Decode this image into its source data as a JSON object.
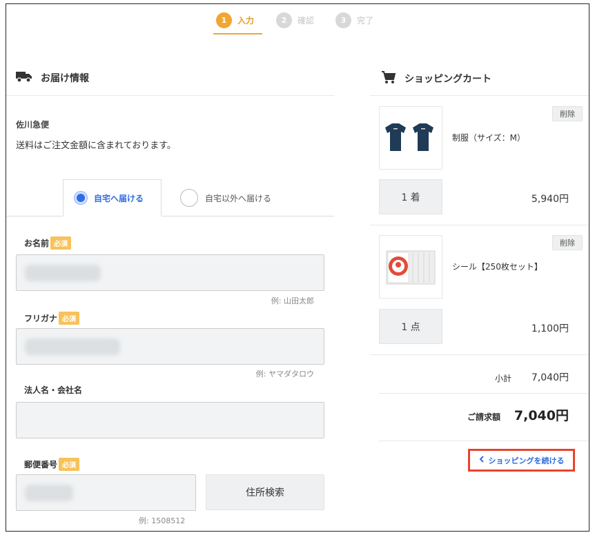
{
  "steps": [
    {
      "num": "1",
      "label": "入力"
    },
    {
      "num": "2",
      "label": "確認"
    },
    {
      "num": "3",
      "label": "完了"
    }
  ],
  "delivery": {
    "title": "お届け情報",
    "icon": "truck-icon",
    "carrier": "佐川急便",
    "shipping_note": "送料はご注文金額に含まれております。",
    "tabs": [
      {
        "label": "自宅へ届ける",
        "selected": true
      },
      {
        "label": "自宅以外へ届ける",
        "selected": false
      }
    ]
  },
  "form": {
    "required_badge": "必須",
    "name": {
      "label": "お名前",
      "example": "例: 山田太郎"
    },
    "furigana": {
      "label": "フリガナ",
      "example": "例: ヤマダタロウ"
    },
    "company": {
      "label": "法人名・会社名"
    },
    "postal": {
      "label": "郵便番号",
      "example": "例: 1508512",
      "search_button": "住所検索"
    }
  },
  "cart": {
    "title": "ショッピングカート",
    "icon": "cart-icon",
    "delete_label": "削除",
    "items": [
      {
        "name": "制服（サイズ：M）",
        "qty": "1 着",
        "price": "5,940円",
        "image": "navy-tshirts"
      },
      {
        "name": "シール【250枚セット】",
        "qty": "1 点",
        "price": "1,100円",
        "image": "sticker-pack"
      }
    ],
    "subtotal_label": "小計",
    "subtotal": "7,040円",
    "total_label": "ご請求額",
    "total": "7,040円",
    "continue_label": "ショッピングを続ける",
    "accent_color": "#2f6de1",
    "highlight_color": "#e8432a"
  }
}
